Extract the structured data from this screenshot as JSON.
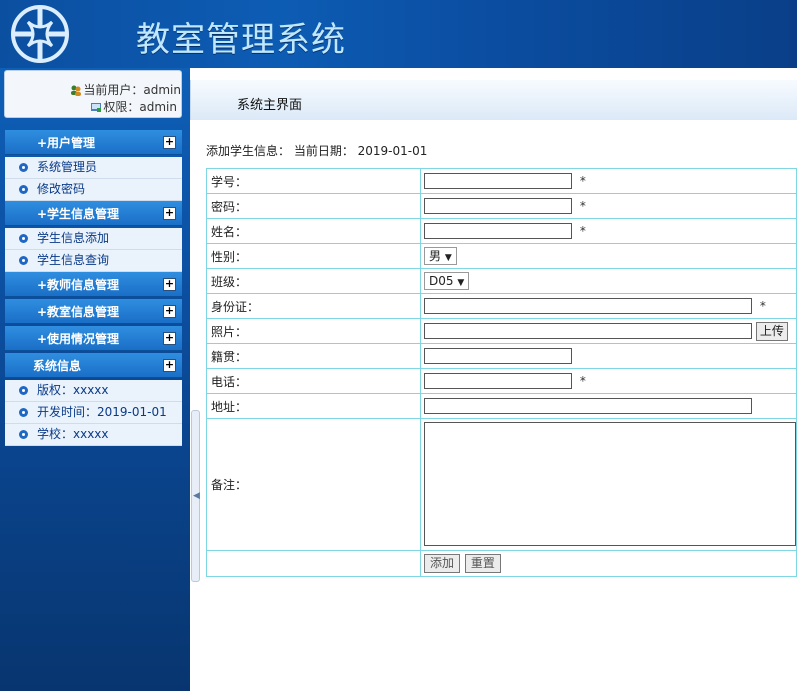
{
  "header": {
    "title": "教室管理系统"
  },
  "user": {
    "current_user": "当前用户：admin",
    "permission": "权限：admin"
  },
  "titlebar": {
    "text": "系统主界面"
  },
  "sidebar": {
    "sections": [
      {
        "label": "+用户管理",
        "items": [
          "系统管理员",
          "修改密码"
        ]
      },
      {
        "label": "+学生信息管理",
        "items": [
          "学生信息添加",
          "学生信息查询"
        ]
      },
      {
        "label": "+教师信息管理",
        "items": []
      },
      {
        "label": "+教室信息管理",
        "items": []
      },
      {
        "label": "+使用情况管理",
        "items": []
      },
      {
        "label": "系统信息",
        "items": [
          "版权：xxxxx",
          "开发时间：2019-01-01",
          "学校：xxxxx"
        ]
      }
    ],
    "toggle_glyph": "+"
  },
  "page": {
    "heading": "添加学生信息：  当前日期：  2019-01-01"
  },
  "form": {
    "student_id_label": "学号：",
    "password_label": "密码：",
    "name_label": "姓名：",
    "gender_label": "性别：",
    "gender_value": "男",
    "class_label": "班级：",
    "class_value": "D05",
    "id_card_label": "身份证：",
    "photo_label": "照片：",
    "upload_label": "上传",
    "native_place_label": "籍贯：",
    "phone_label": "电话：",
    "address_label": "地址：",
    "remark_label": "备注：",
    "required_mark": "*",
    "add_label": "添加",
    "reset_label": "重置",
    "dropdown_arrow": "▼"
  }
}
